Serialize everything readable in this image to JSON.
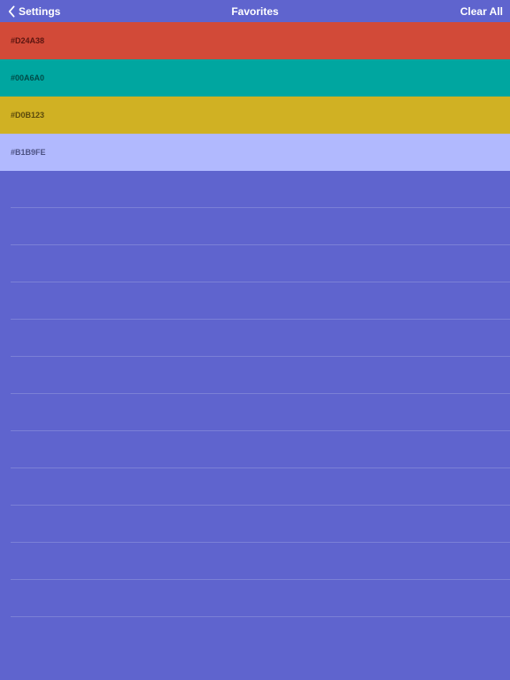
{
  "nav": {
    "back_label": "Settings",
    "title": "Favorites",
    "clear_label": "Clear All"
  },
  "colors": [
    {
      "hex": "#D24A38",
      "bg": "#d24a38",
      "text": "#5b1510"
    },
    {
      "hex": "#00A6A0",
      "bg": "#00a6a0",
      "text": "#004b48"
    },
    {
      "hex": "#D0B123",
      "bg": "#d0b123",
      "text": "#5b4a0c"
    },
    {
      "hex": "#B1B9FE",
      "bg": "#b1b9fe",
      "text": "#4d5284"
    }
  ],
  "empty_slots": 13
}
